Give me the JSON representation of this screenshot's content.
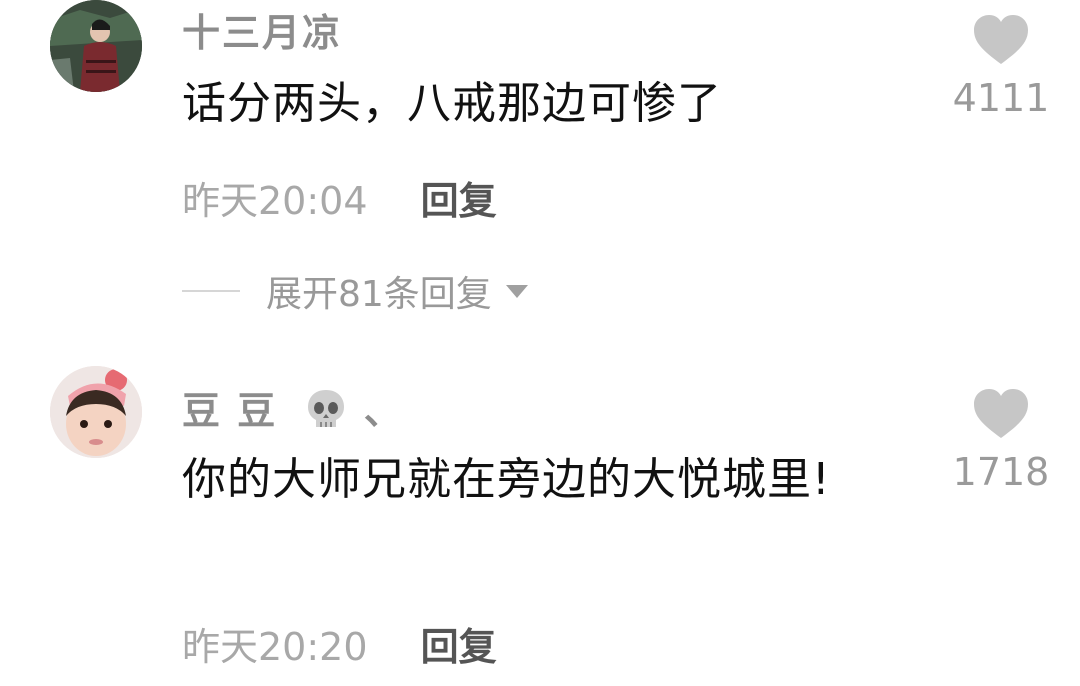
{
  "comments": [
    {
      "username": "十三月凉",
      "text": "话分两头，八戒那边可惨了",
      "time": "昨天20:04",
      "reply_label": "回复",
      "likes": "4111"
    },
    {
      "username": "豆 豆",
      "username_suffix": "、",
      "text": "你的大师兄就在旁边的大悦城里!",
      "time": "昨天20:20",
      "reply_label": "回复",
      "likes": "1718"
    }
  ],
  "expand_replies": {
    "label": "展开81条回复"
  },
  "icons": {
    "like": "heart-icon",
    "expand": "caret-down-icon",
    "username_emoji": "skull-icon"
  },
  "colors": {
    "username": "#8c8c8c",
    "text": "#111111",
    "meta": "#a8a8a8",
    "reply": "#555555",
    "heart": "#c6c6c6"
  }
}
